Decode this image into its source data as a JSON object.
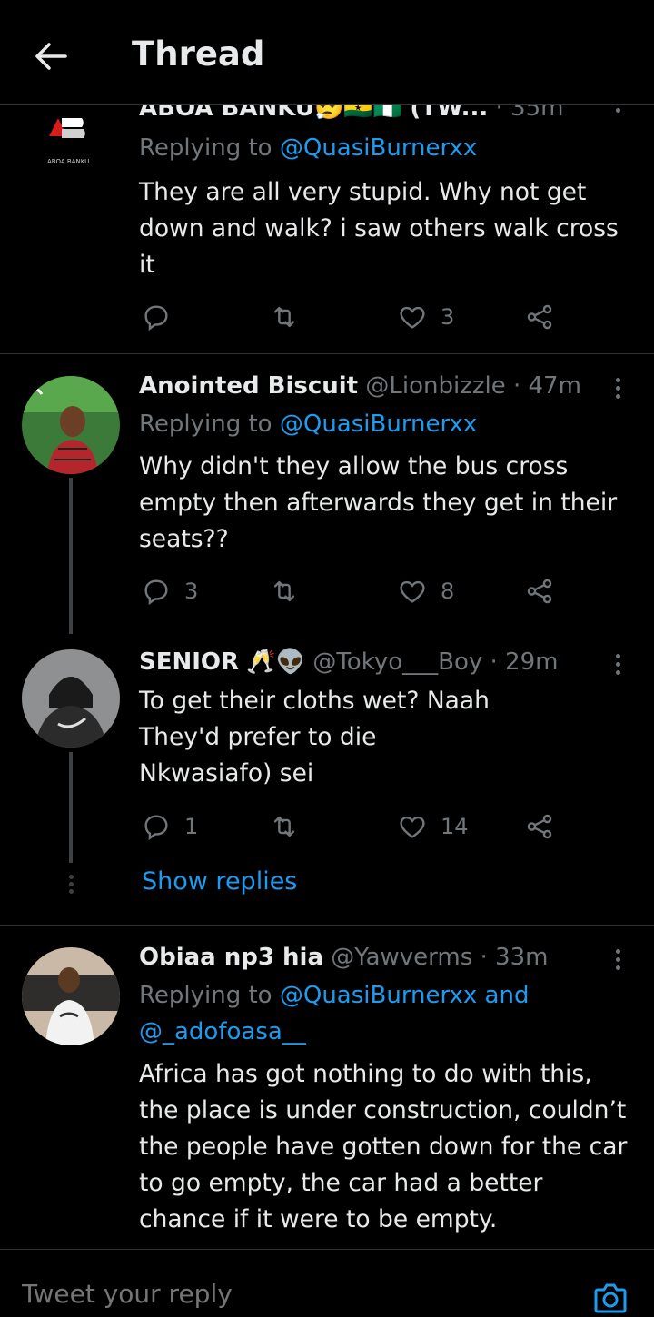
{
  "header": {
    "title": "Thread"
  },
  "colors": {
    "background": "#000000",
    "accent": "#1d9bf0",
    "muted": "#71767b",
    "text": "#e7e9ea",
    "border": "#2f3336"
  },
  "tweets": [
    {
      "name": "ABOA BANKU",
      "emoji": "😮‍💨🇬🇭🇳🇬",
      "handle": "(TW...",
      "time": "· 35m",
      "avatar_text": "ABOA BANKU",
      "replying_prefix": "Replying to",
      "replying_to": "@QuasiBurnerxx",
      "body": "They are all very stupid. Why not get down and walk? i saw others walk cross it",
      "replies": "",
      "retweets": "",
      "likes": "3"
    },
    {
      "name": "Anointed Biscuit",
      "handle": "@Lionbizzle",
      "time": "· 47m",
      "replying_prefix": "Replying to",
      "replying_to": "@QuasiBurnerxx",
      "body": "Why didn't they allow the bus cross empty then afterwards they get in their seats??",
      "replies": "3",
      "retweets": "",
      "likes": "8"
    },
    {
      "name": "SENIOR",
      "emoji": "🥂👽",
      "handle": "@Tokyo___Boy",
      "time": "· 29m",
      "body_lines": [
        "To get their cloths wet? Naah",
        "They'd prefer to die",
        "Nkwasiafo) sei"
      ],
      "replies": "1",
      "retweets": "",
      "likes": "14"
    },
    {
      "name": "Obiaa np3 hia",
      "handle": "@Yawverms",
      "time": "· 33m",
      "replying_prefix": "Replying to",
      "replying_to": "@QuasiBurnerxx and",
      "replying_to_2": "@_adofoasa__",
      "body": "Africa has got nothing to do with this, the place is under construction, couldn’t the people have gotten down for the car to go empty, the car had a better chance if it were to be empty."
    }
  ],
  "show_replies": "Show replies",
  "reply_bar": {
    "placeholder": "Tweet your reply"
  }
}
